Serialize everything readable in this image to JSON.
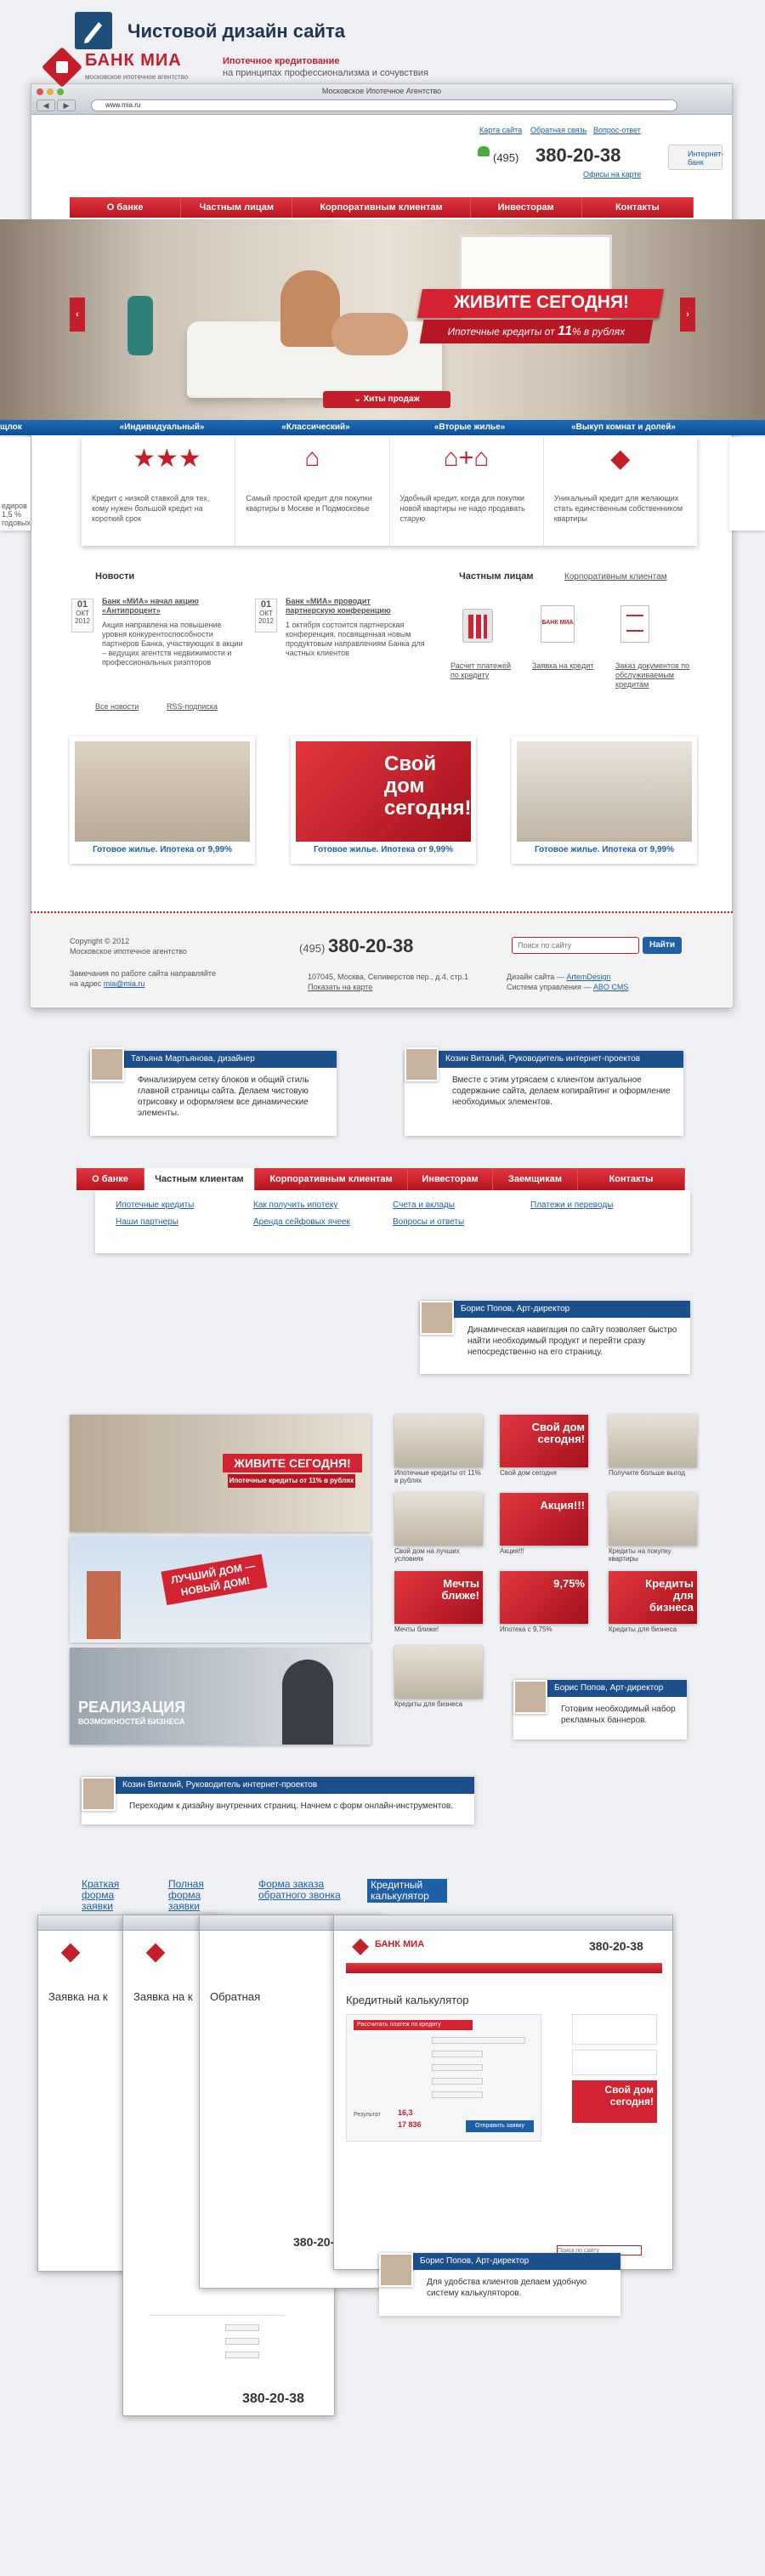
{
  "page": {
    "title": "Чистовой дизайн сайта"
  },
  "browser": {
    "title": "Московское Ипотечное Агентство",
    "url": "www.mia.ru"
  },
  "site": {
    "bank": "БАНК МИА",
    "bank_sub": "московское ипотечное агентство",
    "tagline1": "Ипотечное кредитование",
    "tagline2": "на принципах профессионализма и сочувствия",
    "toplinks": [
      "Карта сайта",
      "Обратная связь",
      "Вопрос-ответ"
    ],
    "phone_prefix": "(495)",
    "phone": "380-20-38",
    "office": "Офисы на карте",
    "ibank": "Интернет-банк",
    "nav": [
      "О банке",
      "Частным лицам",
      "Корпоративным клиентам",
      "Инвесторам",
      "Контакты"
    ]
  },
  "hero": {
    "title": "ЖИВИТЕ СЕГОДНЯ!",
    "subtitle_pre": "Ипотечные кредиты от",
    "rate": "11",
    "subtitle_post": "% в рублях",
    "hits": "Хиты продаж",
    "arrow_left": "‹",
    "arrow_right": "›"
  },
  "product_tabs": {
    "left_edge": "щлок",
    "items": [
      "«Индивидуальный»",
      "«Классический»",
      "«Вторые жилье»",
      "«Выкуп комнат и долей»"
    ]
  },
  "products": [
    {
      "icon": "★★★",
      "text": "Кредит с низкой ставкой для тех, кому нужен большой кредит на короткий срок"
    },
    {
      "icon": "⌂",
      "text": "Самый простой кредит для покупки квартиры в Москве и Подмосковье"
    },
    {
      "icon": "⌂+⌂",
      "text": "Удобный кредит, когда для покупки новой квартиры не надо продавать старую"
    },
    {
      "icon": "◆",
      "text": "Уникальный кредит для желающих стать единственным собственником квартиры"
    }
  ],
  "side_left": {
    "line1": "едиров",
    "line2": "1,5 % годовых"
  },
  "news": {
    "title": "Новости",
    "items": [
      {
        "day": "01",
        "month": "ОКТ",
        "year": "2012",
        "head": "Банк «МИА» начал акцию «Антипроцент»",
        "text": "Акция направлена на повышение уровня конкурентоспособности партнеров Банка, участвующих в акции – ведущих агентств недвижимости и профессиональных риэлторов"
      },
      {
        "day": "01",
        "month": "ОКТ",
        "year": "2012",
        "head": "Банк «МИА» проводит партнерскую конференцию",
        "text": "1 октября состоится партнерская конференция, посвященная новым продуктовым направлениям Банка для частных клиентов"
      }
    ],
    "all": "Все новости",
    "rss": "RSS-подписка"
  },
  "private": {
    "tab1": "Частным лицам",
    "tab2": "Корпоративным клиентам",
    "items": [
      "Расчет платежей по кредиту",
      "Заявка на кредит",
      "Заказ документов по обслуживаемым кредитам"
    ],
    "bank_icon_label": "БАНК МИА"
  },
  "promos": [
    {
      "caption": "Готовое жилье. Ипотека от 9,99%"
    },
    {
      "caption": "Готовое жилье. Ипотека от 9,99%",
      "big": "Свой дом сегодня!"
    },
    {
      "caption": "Готовое жилье. Ипотека от 9,99%"
    }
  ],
  "footer": {
    "copyright": "Copyright © 2012",
    "org": "Московское ипотечное агентство",
    "note": "Замечания по работе сайта направляйте",
    "note2": "на адрес",
    "email": "mia@mia.ru",
    "address": "107045, Москва, Селиверстов пер., д.4, стр.1",
    "map": "Показать на карте",
    "design_pre": "Дизайн сайта —",
    "design": "ArtemDesign",
    "cms_pre": "Система управления —",
    "cms": "ABO CMS",
    "search_placeholder": "Поиск по сайту",
    "search_btn": "Найти"
  },
  "comments": [
    {
      "author": "Татьяна Мартьянова, дизайнер",
      "text": "Финализируем сетку блоков и общий стиль главной страницы сайта. Делаем чистовую отрисовку и оформляем все динамические элементы."
    },
    {
      "author": "Козин Виталий, Руководитель интернет-проектов",
      "text": "Вместе с этим утрясаем с клиентом актуальное содержание сайта, делаем копирайтинг и оформление необходимых элементов."
    },
    {
      "author": "Борис Попов, Арт-директор",
      "text": "Динамическая навигация по сайту позволяет быстро найти необходимый продукт и перейти сразу непосредственно на его страницу."
    },
    {
      "author": "Борис Попов, Арт-директор",
      "text": "Готовим необходимый набор рекламных баннеров."
    },
    {
      "author": "Козин Виталий, Руководитель интернет-проектов",
      "text": "Переходим к дизайну внутренних страниц. Начнем с форм онлайн-инструментов."
    },
    {
      "author": "Борис Попов, Арт-директор",
      "text": "Для удобства клиентов делаем удобную систему калькуляторов."
    }
  ],
  "mega": {
    "nav": [
      "О банке",
      "Частным клиентам",
      "Корпоративным клиентам",
      "Инвесторам",
      "Заемщикам",
      "Контакты"
    ],
    "col1": [
      "Ипотечные кредиты",
      "Наши партнеры"
    ],
    "col2": [
      "Как получить ипотеку",
      "Аренда сейфовых ячеек"
    ],
    "col3": [
      "Счета и вклады",
      "Вопросы и ответы"
    ],
    "col4": [
      "Платежи и переводы"
    ]
  },
  "banners": {
    "big1": {
      "title": "ЖИВИТЕ СЕГОДНЯ!",
      "sub": "Ипотечные кредиты от 11% в рублях"
    },
    "big2": {
      "title": "ЛУЧШИЙ ДОМ — НОВЫЙ ДОМ!"
    },
    "big3": {
      "title": "РЕАЛИЗАЦИЯ",
      "sub": "ВОЗМОЖНОСТЕЙ БИЗНЕСА"
    },
    "small": [
      {
        "cap": "Ипотечные кредиты от 11% в рублях"
      },
      {
        "cap": "Свой дом сегодня",
        "big": "Свой дом сегодня!"
      },
      {
        "cap": "Получите больше выгод"
      },
      {
        "cap": "Свой дом на лучших условиях"
      },
      {
        "cap": "Акция!!!",
        "big": "Акция!!!"
      },
      {
        "cap": "Кредиты на покупку квартиры"
      },
      {
        "cap": "Мечты ближе!",
        "big": "Мечты ближе!"
      },
      {
        "cap": "Ипотека с 9,75%",
        "big": "9,75%"
      },
      {
        "cap": "Кредиты для бизнеса",
        "big": "Кредиты для бизнеса"
      },
      {
        "cap": "Кредиты для бизнеса"
      }
    ]
  },
  "inner_tabs": [
    "Краткая форма заявки",
    "Полная форма заявки",
    "Форма заказа обратного звонка",
    "Кредитный калькулятор"
  ],
  "inner": {
    "page1": "Заявка на к",
    "page2": "Заявка на к",
    "page3": "Обратная",
    "page4": "Кредитный калькулятор",
    "calc_btn": "Рассчитать платеж по кредиту",
    "result_label": "Результат",
    "result1": "16,3",
    "result2": "17 836",
    "apply": "Отправить заявку"
  }
}
